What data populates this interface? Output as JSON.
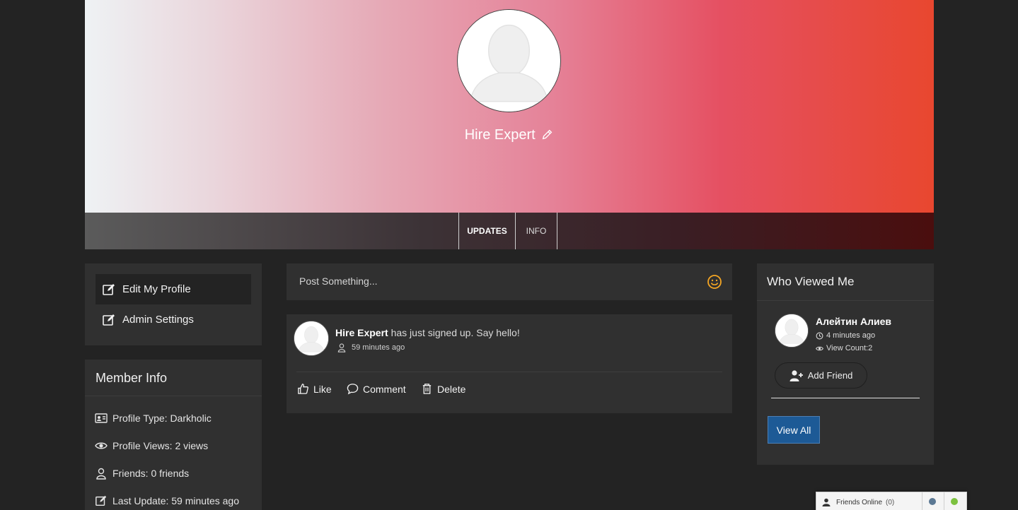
{
  "profile": {
    "name": "Hire Expert"
  },
  "tabs": [
    {
      "label": "UPDATES",
      "active": true
    },
    {
      "label": "INFO",
      "active": false
    }
  ],
  "left_menu": [
    {
      "label": "Edit My Profile",
      "icon": "edit-icon",
      "active": true
    },
    {
      "label": "Admin Settings",
      "icon": "edit-icon",
      "active": false
    }
  ],
  "member_info": {
    "title": "Member Info",
    "rows": [
      {
        "icon": "id-card-icon",
        "text": "Profile Type: Darkholic"
      },
      {
        "icon": "eye-icon",
        "text": "Profile Views: 2 views"
      },
      {
        "icon": "user-icon",
        "text": "Friends: 0 friends"
      },
      {
        "icon": "edit-icon",
        "text": "Last Update: 59 minutes ago"
      }
    ]
  },
  "composer": {
    "placeholder": "Post Something..."
  },
  "feed": {
    "author": "Hire Expert",
    "message": " has just signed up. Say hello!",
    "time": "59 minutes ago",
    "actions": [
      "Like",
      "Comment",
      "Delete"
    ]
  },
  "who_viewed": {
    "title": "Who Viewed Me",
    "viewer_name": "Алейтин Алиев",
    "viewer_time": "4 minutes ago",
    "viewer_count": "View Count:2",
    "add_friend": "Add Friend",
    "view_all": "View All"
  },
  "chat_bar": {
    "label": "Friends Online",
    "count": "(0)"
  },
  "colors": {
    "accent_button": "#1d5a96",
    "smile": "#f5a623",
    "online_dot": "#7cc13f",
    "away_dot": "#5b7893"
  }
}
